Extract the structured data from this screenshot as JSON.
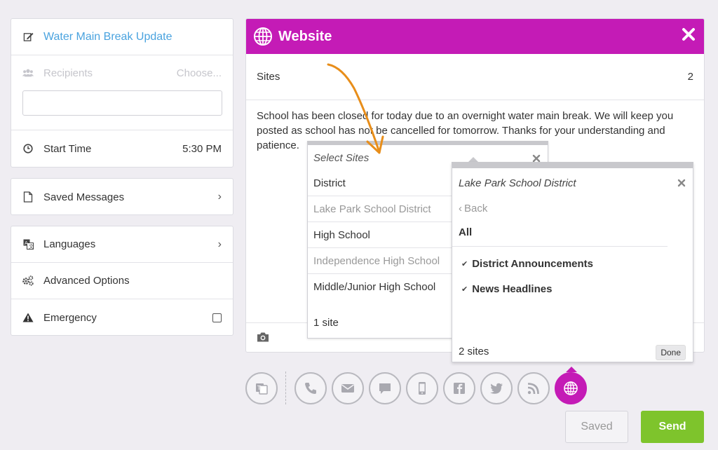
{
  "compose": {
    "title": "Water Main Break Update",
    "recipients_label": "Recipients",
    "recipients_action": "Choose...",
    "recipients_input_value": "",
    "start_time_label": "Start Time",
    "start_time_value": "5:30 PM"
  },
  "saved_messages": {
    "label": "Saved Messages"
  },
  "options": {
    "languages": "Languages",
    "advanced": "Advanced Options",
    "emergency": "Emergency"
  },
  "website": {
    "title": "Website",
    "sites_label": "Sites",
    "sites_count": "2",
    "message": "School has been closed for today due to an overnight water main break. We will keep you posted as school has not be cancelled for tomorrow. Thanks for your understanding and patience."
  },
  "select_sites": {
    "title": "Select Sites",
    "rows": [
      {
        "label": "District",
        "muted": false
      },
      {
        "label": "Lake Park School District",
        "muted": true
      },
      {
        "label": "High School",
        "muted": false
      },
      {
        "label": "Independence High School",
        "muted": true
      },
      {
        "label": "Middle/Junior High School",
        "muted": false
      }
    ],
    "footer": "1 site"
  },
  "district_popup": {
    "title": "Lake Park School District",
    "back": "Back",
    "all": "All",
    "items": [
      "District Announcements",
      "News Headlines"
    ],
    "footer": "2 sites",
    "done": "Done"
  },
  "channels": [
    "translate-icon",
    "phone-icon",
    "email-icon",
    "chat-icon",
    "mobile-icon",
    "facebook-icon",
    "twitter-icon",
    "rss-icon",
    "globe-icon"
  ],
  "buttons": {
    "saved": "Saved",
    "send": "Send"
  },
  "colors": {
    "accent": "#c41bb6",
    "send": "#7ec42c",
    "link": "#4aa3df"
  }
}
